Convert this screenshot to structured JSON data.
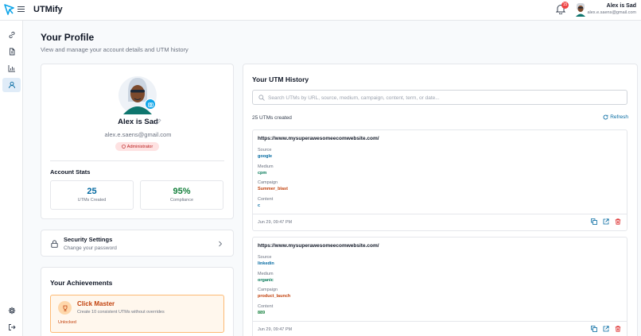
{
  "app": {
    "name": "UTMify"
  },
  "header": {
    "notification_count": "15",
    "user_name": "Alex is Sad",
    "user_email": "alex.e.saens@gmail.com"
  },
  "page": {
    "title": "Your Profile",
    "subtitle": "View and manage your account details and UTM history"
  },
  "profile": {
    "name": "Alex is Sad",
    "email": "alex.e.saens@gmail.com",
    "role": "Administrator",
    "stats_title": "Account Stats",
    "stats": [
      {
        "value": "25",
        "label": "UTMs Created",
        "color": "#0369a1"
      },
      {
        "value": "95%",
        "label": "Compliance",
        "color": "#15803d"
      }
    ]
  },
  "security": {
    "title": "Security Settings",
    "subtitle": "Change your password"
  },
  "achievements": {
    "title": "Your Achievements",
    "items": [
      {
        "name": "Click Master",
        "description": "Create 10 consistent UTMs without overrides",
        "status": "Unlocked"
      }
    ]
  },
  "history": {
    "title": "Your UTM History",
    "search_placeholder": "Search UTMs by URL, source, medium, campaign, content, term, or date...",
    "count_text": "25 UTMs created",
    "refresh_label": "Refresh",
    "field_labels": {
      "source": "Source",
      "medium": "Medium",
      "campaign": "Campaign",
      "content": "Content"
    },
    "entries": [
      {
        "url": "https://www.mysuperawesomeecomwebsite.com/",
        "source": "google",
        "medium": "cpm",
        "campaign": "Summer_blast",
        "content": "c",
        "date": "Jun 29, 09:47 PM"
      },
      {
        "url": "https://www.mysuperawesomeecomwebsite.com/",
        "source": "linkedin",
        "medium": "organic",
        "campaign": "product_launch",
        "content": "889",
        "date": "Jun 29, 09:47 PM"
      }
    ]
  },
  "colors": {
    "source": "#0369a1",
    "medium": "#047857",
    "campaign": "#c2410c",
    "content_1": "#0369a1",
    "content_2": "#15803d",
    "accent": "#0369a1"
  }
}
